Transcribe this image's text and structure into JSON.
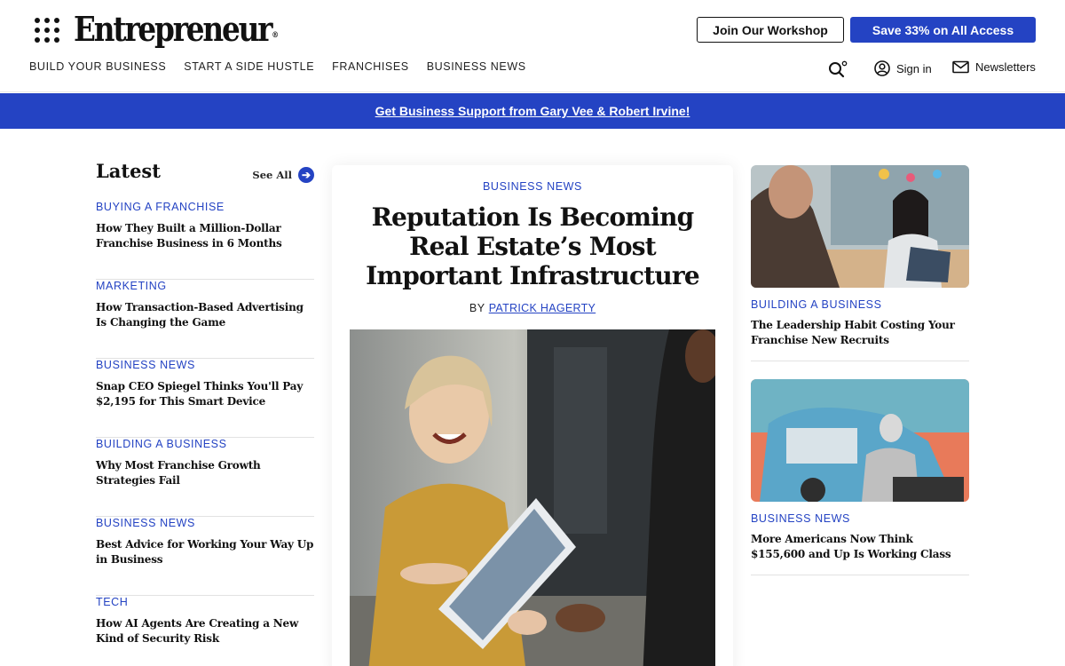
{
  "header": {
    "logo_text": "Entrepreneur",
    "logo_mark": "®",
    "workshop_button": "Join Our Workshop",
    "access_button": "Save 33% on All Access",
    "sign_in": "Sign in",
    "newsletters": "Newsletters"
  },
  "nav": [
    {
      "label": "BUILD YOUR BUSINESS"
    },
    {
      "label": "START A SIDE HUSTLE"
    },
    {
      "label": "FRANCHISES"
    },
    {
      "label": "BUSINESS NEWS"
    }
  ],
  "promo": {
    "text": "Get Business Support from Gary Vee & Robert Irvine!"
  },
  "latest": {
    "title": "Latest",
    "see_all": "See All",
    "items": [
      {
        "category": "BUYING A FRANCHISE",
        "headline": "How They Built a Million-Dollar Franchise Business in 6 Months"
      },
      {
        "category": "MARKETING",
        "headline": "How Transaction-Based Advertising Is Changing the Game"
      },
      {
        "category": "BUSINESS NEWS",
        "headline": "Snap CEO Spiegel Thinks You'll Pay $2,195 for This Smart Device"
      },
      {
        "category": "BUILDING A BUSINESS",
        "headline": "Why Most Franchise Growth Strategies Fail"
      },
      {
        "category": "BUSINESS NEWS",
        "headline": "Best Advice for Working Your Way Up in Business"
      },
      {
        "category": "TECH",
        "headline": "How AI Agents Are Creating a New Kind of Security Risk"
      }
    ]
  },
  "feature": {
    "category": "BUSINESS NEWS",
    "title": "Reputation Is Becoming Real Estate’s Most Important Infrastructure",
    "by": "BY",
    "author": "PATRICK HAGERTY"
  },
  "side": [
    {
      "category": "BUILDING A BUSINESS",
      "headline": "The Leadership Habit Costing Your Franchise New Recruits"
    },
    {
      "category": "BUSINESS NEWS",
      "headline": "More Americans Now Think $155,600 and Up Is Working Class"
    }
  ],
  "colors": {
    "accent": "#2443c3",
    "text": "#111111",
    "divider": "#e2e2e2"
  }
}
